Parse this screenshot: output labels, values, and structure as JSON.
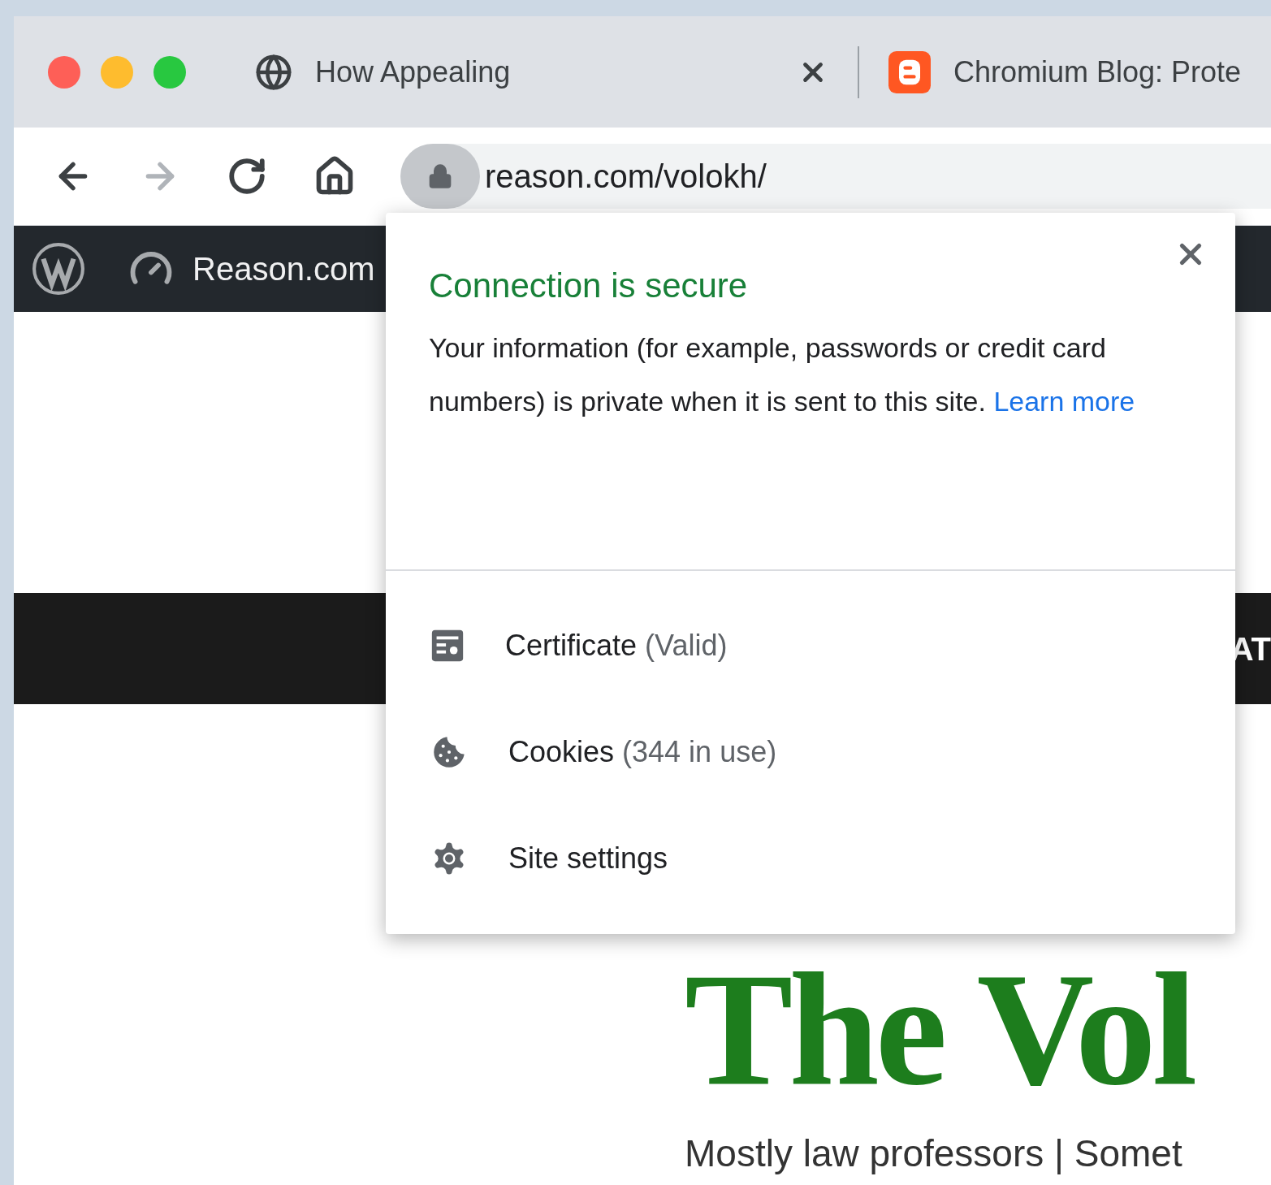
{
  "tabs": [
    {
      "kind": "globe",
      "title": "How Appealing"
    },
    {
      "kind": "blog",
      "title": "Chromium Blog: Prote"
    }
  ],
  "toolbar": {
    "forward_disabled": true,
    "url": "reason.com/volokh/"
  },
  "admin_bar": {
    "site": "Reason.com"
  },
  "nav_bar": {
    "item_fragment": "AT"
  },
  "header": {
    "title": "The Vol",
    "tagline": "Mostly law professors | Somet"
  },
  "popup": {
    "title": "Connection is secure",
    "body": "Your information (for example, passwords or credit card numbers) is private when it is sent to this site.",
    "link": "Learn more",
    "items": [
      {
        "kind": "certificate",
        "label": "Certificate",
        "detail": "(Valid)"
      },
      {
        "kind": "cookies",
        "label": "Cookies",
        "detail": "(344 in use)"
      },
      {
        "kind": "settings",
        "label": "Site settings"
      }
    ]
  }
}
